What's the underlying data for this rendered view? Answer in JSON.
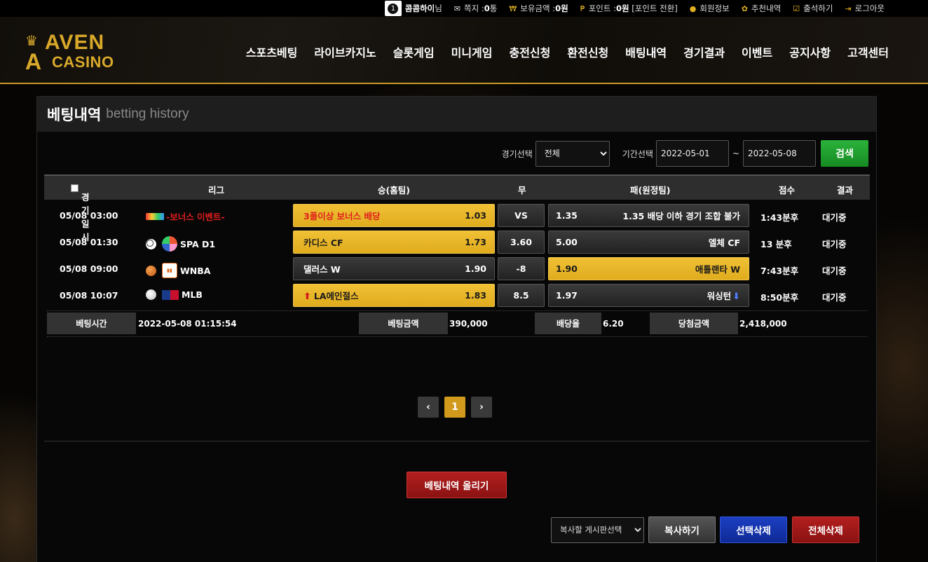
{
  "topbar": {
    "level": "1",
    "username": "콤콤하이",
    "username_suffix": "님",
    "message_label": "쪽지 : ",
    "message_count": "0",
    "message_unit": " 통",
    "balance_label": "보유금액 : ",
    "balance_value": "0원",
    "point_label": "포인트 : ",
    "point_value": "0원",
    "point_convert": "[포인트 전환]",
    "member_info": "회원정보",
    "referral": "추천내역",
    "attendance": "출석하기",
    "logout": "로그아웃"
  },
  "logo": {
    "line1": "AVEN",
    "letter": "A",
    "line2": "CASINO"
  },
  "nav": [
    "스포츠베팅",
    "라이브카지노",
    "슬롯게임",
    "미니게임",
    "충전신청",
    "환전신청",
    "배팅내역",
    "경기결과",
    "이벤트",
    "공지사항",
    "고객센터"
  ],
  "page": {
    "title": "베팅내역",
    "subtitle": "betting history"
  },
  "filter": {
    "game_label": "경기선택",
    "game_value": "전체",
    "period_label": "기간선택",
    "date_from": "2022-05-01",
    "tilde": "~",
    "date_to": "2022-05-08",
    "search_label": "검색"
  },
  "table": {
    "headers": {
      "time": "경기일시",
      "league": "리그",
      "home": "승(홈팀)",
      "draw": "무",
      "away": "패(원정팀)",
      "score": "점수",
      "result": "결과"
    },
    "rows": [
      {
        "time": "05/08 03:00",
        "league": "-보너스 이벤트-",
        "home_team": "3폴이상 보너스 배당",
        "home_odds": "1.03",
        "draw": "VS",
        "away_odds": "1.35",
        "away_team": "1.35 배당 이하 경기 조합 불가",
        "score": "1:43분후",
        "result": "대기중"
      },
      {
        "time": "05/08 01:30",
        "league": "SPA D1",
        "home_team": "카디스 CF",
        "home_odds": "1.73",
        "draw": "3.60",
        "away_odds": "5.00",
        "away_team": "엘체 CF",
        "score": "13 분후",
        "result": "대기중"
      },
      {
        "time": "05/08 09:00",
        "league": "WNBA",
        "home_team": "댈러스 W",
        "home_odds": "1.90",
        "draw": "-8",
        "away_odds": "1.90",
        "away_team": "애틀랜타 W",
        "score": "7:43분후",
        "result": "대기중"
      },
      {
        "time": "05/08 10:07",
        "league": "MLB",
        "home_team": "LA에인절스",
        "home_odds": "1.83",
        "draw": "8.5",
        "away_odds": "1.97",
        "away_team": "워싱턴",
        "score": "8:50분후",
        "result": "대기중"
      }
    ]
  },
  "summary": {
    "bet_time_label": "베팅시간",
    "bet_time": "2022-05-08 01:15:54",
    "bet_amount_label": "베팅금액",
    "bet_amount": "390,000",
    "odds_label": "배당율",
    "odds": "6.20",
    "win_amount_label": "당첨금액",
    "win_amount": "2,418,000"
  },
  "pagination": {
    "prev": "‹",
    "current": "1",
    "next": "›"
  },
  "actions": {
    "upload": "베팅내역 올리기",
    "board_select": "복사할 게시판선택",
    "copy": "복사하기",
    "delete_selected": "선택삭제",
    "delete_all": "전체삭제"
  },
  "colors": {
    "accent_gold": "#e0ac1e",
    "search_green": "#1e9e2c",
    "delete_red": "#a51a1a",
    "select_blue": "#1838b0"
  }
}
